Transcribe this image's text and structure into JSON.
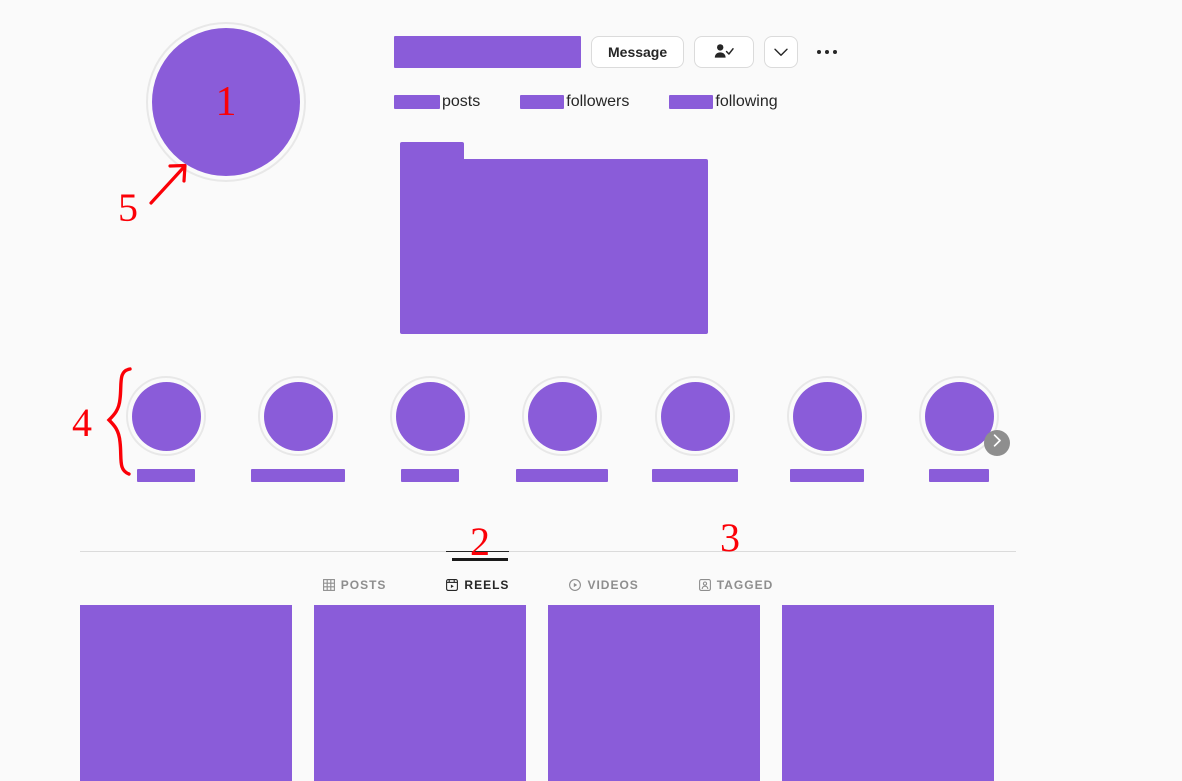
{
  "page": {
    "background_color": "#fafafa",
    "redaction_color": "#8a5cd9",
    "annotation_color": "#fb0007"
  },
  "profile": {
    "avatar": {
      "annotation_number": "1",
      "icon": "avatar-image"
    },
    "username_redacted": true,
    "actions": {
      "message_label": "Message",
      "following_icon": "person-check-icon",
      "dropdown_icon": "chevron-down-icon",
      "options_icon": "ellipsis-icon"
    },
    "stats": [
      {
        "label": "posts",
        "value_redacted": true
      },
      {
        "label": "followers",
        "value_redacted": true
      },
      {
        "label": "following",
        "value_redacted": true
      }
    ],
    "bio_redacted": true
  },
  "highlights": {
    "next_icon": "chevron-right-icon",
    "items": [
      {
        "name": "highlight-1",
        "label_width": 58
      },
      {
        "name": "highlight-2",
        "label_width": 94
      },
      {
        "name": "highlight-3",
        "label_width": 58
      },
      {
        "name": "highlight-4",
        "label_width": 92
      },
      {
        "name": "highlight-5",
        "label_width": 86
      },
      {
        "name": "highlight-6",
        "label_width": 74
      },
      {
        "name": "highlight-7",
        "label_width": 60
      }
    ]
  },
  "tabs": [
    {
      "label": "POSTS",
      "icon": "grid-icon",
      "active": false
    },
    {
      "label": "REELS",
      "icon": "reels-icon",
      "active": true
    },
    {
      "label": "VIDEOS",
      "icon": "play-circle-icon",
      "active": false
    },
    {
      "label": "TAGGED",
      "icon": "tagged-person-icon",
      "active": false
    }
  ],
  "post_grid": {
    "tiles": [
      {
        "name": "post-tile-1"
      },
      {
        "name": "post-tile-2"
      },
      {
        "name": "post-tile-3"
      },
      {
        "name": "post-tile-4"
      }
    ]
  },
  "annotations": [
    {
      "id": "annot-1",
      "number": "1",
      "target": "profile-avatar"
    },
    {
      "id": "annot-2",
      "number": "2",
      "target": "reels-tab"
    },
    {
      "id": "annot-3",
      "number": "3",
      "target": "tagged-tab"
    },
    {
      "id": "annot-4",
      "number": "4",
      "target": "story-highlights"
    },
    {
      "id": "annot-5",
      "number": "5",
      "target": "profile-avatar"
    }
  ]
}
